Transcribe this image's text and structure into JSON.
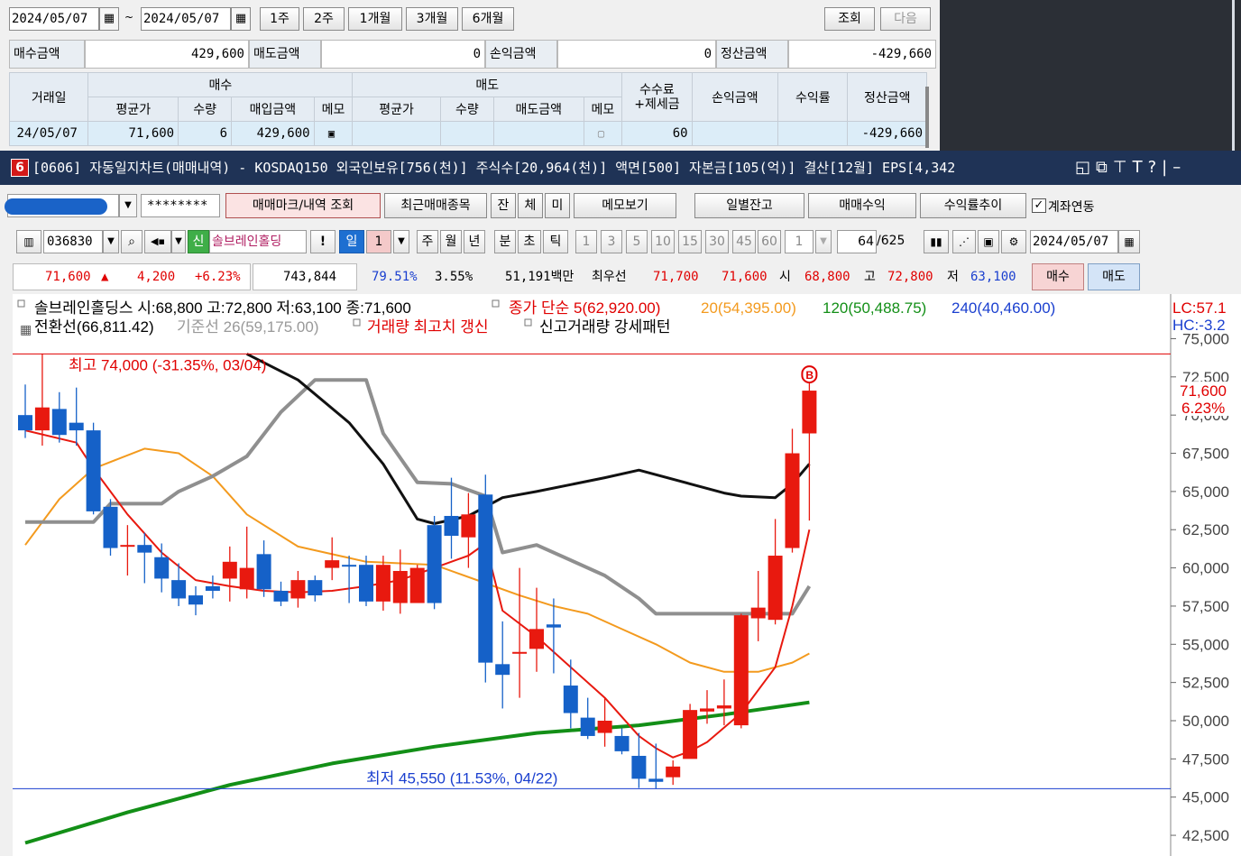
{
  "top": {
    "date_from": "2024/05/07",
    "date_sep": "~",
    "date_to": "2024/05/07",
    "period_buttons": [
      "1주",
      "2주",
      "1개월",
      "3개월",
      "6개월"
    ],
    "query": "조회",
    "next": "다음",
    "summary": [
      {
        "label": "매수금액",
        "value": "429,600"
      },
      {
        "label": "매도금액",
        "value": "0"
      },
      {
        "label": "손익금액",
        "value": "0"
      },
      {
        "label": "정산금액",
        "value": "-429,660"
      }
    ],
    "table": {
      "h_date": "거래일",
      "h_buy": "매수",
      "h_sell": "매도",
      "h_fee": "수수료\n+제세금",
      "h_fee1": "수수료",
      "h_fee2": "+제세금",
      "h_pnl": "손익금액",
      "h_rate": "수익률",
      "h_settle": "정산금액",
      "buy_sub": [
        "평균가",
        "수량",
        "매입금액",
        "메모"
      ],
      "sell_sub": [
        "평균가",
        "수량",
        "매도금액",
        "메모"
      ],
      "row": {
        "date": "24/05/07",
        "buy_avg": "71,600",
        "buy_qty": "6",
        "buy_amt": "429,600",
        "sell_avg": "",
        "sell_qty": "",
        "sell_amt": "",
        "fee": "60",
        "pnl": "",
        "rate": "",
        "settle": "-429,660"
      }
    }
  },
  "window": {
    "number": "6",
    "title": "[0606] 자동일지차트(매매내역) - KOSDAQ150 외국인보유[756(천)] 주식수[20,964(천)] 액면[500] 자본금[105(억)] 결산[12월] EPS[4,342"
  },
  "toolbar1": {
    "account_mask": "********",
    "buttons": [
      "매매마크/내역 조회",
      "최근매매종목",
      "잔",
      "체",
      "미",
      "메모보기",
      "일별잔고",
      "매매수익",
      "수익률추이"
    ],
    "checkbox_label": "계좌연동",
    "checkbox_checked": true
  },
  "toolbar2": {
    "code": "036830",
    "new_badge": "신",
    "stock_name": "솔브레인홀딩",
    "excl": "!",
    "periods": [
      "일",
      "1",
      "주",
      "월",
      "년",
      "분",
      "초",
      "틱"
    ],
    "intervals": [
      "1",
      "3",
      "5",
      "10",
      "15",
      "30",
      "45",
      "60"
    ],
    "num": "1",
    "count": "64",
    "total": "/625",
    "date": "2024/05/07"
  },
  "price_bar": {
    "price": "71,600",
    "arrow": "▲",
    "change": "4,200",
    "pct": "+6.23%",
    "volume": "743,844",
    "ratio1": "79.51%",
    "ratio2": "3.55%",
    "amount": "51,191백만",
    "best_label": "최우선",
    "ask": "71,700",
    "bid": "71,600",
    "open_label": "시",
    "open": "68,800",
    "high_label": "고",
    "high": "72,800",
    "low_label": "저",
    "low": "63,100",
    "buy": "매수",
    "sell": "매도"
  },
  "chart_data": {
    "type": "candlestick",
    "legend_line1": "솔브레인홀딩스 시:68,800 고:72,800 저:63,100 종:71,600",
    "legend_ma": "종가 단순 5(62,920.00)",
    "legend_ma20": "20(54,395.00)",
    "legend_ma120": "120(50,488.75)",
    "legend_ma240": "240(40,460.00)",
    "legend_line2a": "전환선(66,811.42)",
    "legend_line2b": "기준선 26(59,175.00)",
    "legend_line2c": "거래량 최고치 갱신",
    "legend_line2d": "신고거래량 강세패턴",
    "high_label": "최고 74,000 (-31.35%, 03/04)",
    "low_label": "최저 45,550 (11.53%, 04/22)",
    "lc": "LC:57.1",
    "hc": "HC:-3.2",
    "current_price": "71,600",
    "current_pct": "6.23%",
    "buy_mark": "B",
    "ylim": [
      41500,
      75500
    ],
    "yticks": [
      "75,000",
      "72,500",
      "70,000",
      "67,500",
      "65,000",
      "62,500",
      "60,000",
      "57,500",
      "55,000",
      "52,500",
      "50,000",
      "47,500",
      "45,000",
      "42,500"
    ],
    "high_line": 74000,
    "low_line": 45550,
    "candles": [
      [
        70000,
        72000,
        68500,
        69000
      ],
      [
        69000,
        74000,
        68000,
        70500
      ],
      [
        70400,
        71500,
        68200,
        68700
      ],
      [
        69500,
        71800,
        68000,
        69000
      ],
      [
        69000,
        69500,
        63500,
        63700
      ],
      [
        64000,
        64500,
        60800,
        61300
      ],
      [
        61400,
        62800,
        59500,
        61500
      ],
      [
        61500,
        62300,
        59000,
        61000
      ],
      [
        60700,
        61600,
        58400,
        59300
      ],
      [
        59200,
        60300,
        57500,
        58000
      ],
      [
        58200,
        58800,
        56900,
        57600
      ],
      [
        58800,
        59500,
        58000,
        58500
      ],
      [
        59300,
        61400,
        57800,
        60400
      ],
      [
        58600,
        62700,
        58000,
        60000
      ],
      [
        60900,
        61800,
        58100,
        58600
      ],
      [
        58500,
        59100,
        57500,
        57800
      ],
      [
        58000,
        59800,
        57400,
        59200
      ],
      [
        59200,
        59500,
        57800,
        58200
      ],
      [
        60000,
        62000,
        59200,
        60500
      ],
      [
        60200,
        60800,
        57700,
        60100
      ],
      [
        60200,
        60800,
        57500,
        57800
      ],
      [
        57800,
        60800,
        57200,
        60200
      ],
      [
        57700,
        61200,
        57000,
        59800
      ],
      [
        57700,
        60200,
        57800,
        60000
      ],
      [
        62800,
        63400,
        57300,
        57700
      ],
      [
        63400,
        65900,
        60600,
        62100
      ],
      [
        62000,
        64900,
        60000,
        63500
      ],
      [
        64800,
        66100,
        52500,
        53800
      ],
      [
        53700,
        56500,
        50800,
        53000
      ],
      [
        54500,
        60000,
        51500,
        54500
      ],
      [
        54700,
        58700,
        53200,
        56000
      ],
      [
        56300,
        58000,
        53100,
        56100
      ],
      [
        52300,
        54000,
        49500,
        50500
      ],
      [
        50200,
        51500,
        48800,
        49000
      ],
      [
        49200,
        51500,
        48300,
        50000
      ],
      [
        49000,
        49500,
        47800,
        48000
      ],
      [
        47700,
        49200,
        45600,
        46200
      ],
      [
        46200,
        48500,
        45550,
        46000
      ],
      [
        46300,
        47400,
        45800,
        47000
      ],
      [
        47500,
        51100,
        47600,
        50700
      ],
      [
        50600,
        52000,
        49800,
        50800
      ],
      [
        50800,
        52700,
        49700,
        51000
      ],
      [
        49700,
        57000,
        49500,
        56900
      ],
      [
        56700,
        59800,
        55200,
        57400
      ],
      [
        56600,
        63200,
        56300,
        60800
      ],
      [
        61300,
        69100,
        61000,
        67500
      ],
      [
        68800,
        72800,
        63100,
        71600
      ]
    ],
    "ma5": [
      [
        0,
        69000
      ],
      [
        3,
        68200
      ],
      [
        4,
        66500
      ],
      [
        6,
        63500
      ],
      [
        8,
        61000
      ],
      [
        10,
        59200
      ],
      [
        12,
        58800
      ],
      [
        14,
        58500
      ],
      [
        16,
        58400
      ],
      [
        18,
        58500
      ],
      [
        20,
        58800
      ],
      [
        22,
        59200
      ],
      [
        24,
        60000
      ],
      [
        26,
        60800
      ],
      [
        27,
        61600
      ],
      [
        28,
        57200
      ],
      [
        30,
        55500
      ],
      [
        32,
        53500
      ],
      [
        34,
        51500
      ],
      [
        36,
        49000
      ],
      [
        37,
        48200
      ],
      [
        38,
        47600
      ],
      [
        39,
        48000
      ],
      [
        40,
        48600
      ],
      [
        42,
        50500
      ],
      [
        44,
        53500
      ],
      [
        45,
        57500
      ],
      [
        46,
        62500
      ]
    ],
    "ma20": [
      [
        0,
        61500
      ],
      [
        2,
        64500
      ],
      [
        4,
        66500
      ],
      [
        7,
        67800
      ],
      [
        9,
        67500
      ],
      [
        11,
        66000
      ],
      [
        13,
        63500
      ],
      [
        16,
        61400
      ],
      [
        20,
        60400
      ],
      [
        24,
        60200
      ],
      [
        27,
        59000
      ],
      [
        29,
        58200
      ],
      [
        31,
        57500
      ],
      [
        33,
        57000
      ],
      [
        35,
        56000
      ],
      [
        37,
        55000
      ],
      [
        39,
        53800
      ],
      [
        41,
        53200
      ],
      [
        43,
        53200
      ],
      [
        45,
        53800
      ],
      [
        46,
        54400
      ]
    ],
    "ma120": [
      [
        0,
        42000
      ],
      [
        6,
        44000
      ],
      [
        12,
        45800
      ],
      [
        18,
        47200
      ],
      [
        24,
        48300
      ],
      [
        30,
        49200
      ],
      [
        36,
        49700
      ],
      [
        41,
        50400
      ],
      [
        46,
        51200
      ]
    ],
    "kijun": [
      [
        0,
        63000
      ],
      [
        4,
        63000
      ],
      [
        5,
        64200
      ],
      [
        8,
        64200
      ],
      [
        9,
        65000
      ],
      [
        11,
        66000
      ],
      [
        13,
        67300
      ],
      [
        15,
        70200
      ],
      [
        17,
        72300
      ],
      [
        20,
        72300
      ],
      [
        21,
        68800
      ],
      [
        23,
        65600
      ],
      [
        25,
        65500
      ],
      [
        27,
        64700
      ],
      [
        28,
        61000
      ],
      [
        30,
        61500
      ],
      [
        32,
        60500
      ],
      [
        34,
        59500
      ],
      [
        36,
        58000
      ],
      [
        37,
        57000
      ],
      [
        45,
        57000
      ],
      [
        46,
        58800
      ]
    ],
    "tenkan": [
      [
        13,
        74000
      ],
      [
        16,
        72300
      ],
      [
        19,
        69500
      ],
      [
        21,
        66800
      ],
      [
        23,
        63200
      ],
      [
        24,
        62900
      ],
      [
        26,
        63400
      ],
      [
        28,
        64600
      ],
      [
        30,
        65000
      ],
      [
        34,
        65900
      ],
      [
        36,
        66400
      ],
      [
        39,
        65500
      ],
      [
        41,
        64900
      ],
      [
        42,
        64700
      ],
      [
        44,
        64600
      ],
      [
        45,
        65500
      ],
      [
        46,
        66800
      ]
    ]
  }
}
